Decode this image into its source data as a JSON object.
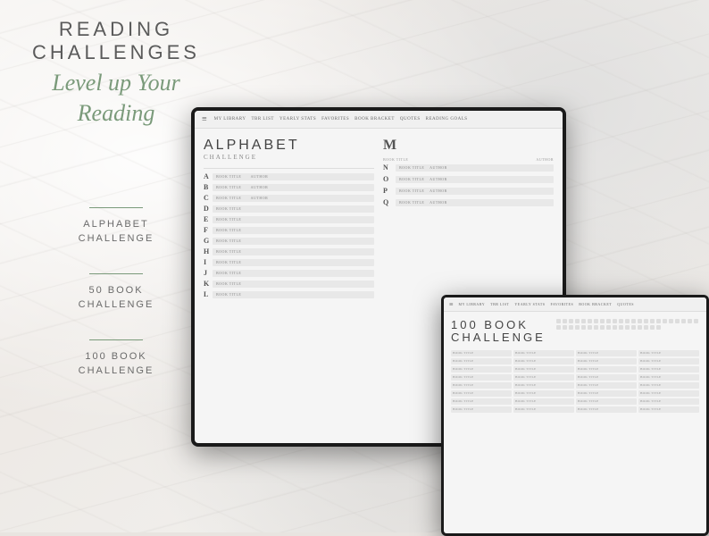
{
  "header": {
    "title_line1": "READING CHALLENGES",
    "title_line2": "Level up Your Reading"
  },
  "challenges": [
    {
      "label": "ALPHABET\nCHALLENGE"
    },
    {
      "label": "50 BOOK\nCHALLENGE"
    },
    {
      "label": "100 BOOK\nCHALLENGE"
    }
  ],
  "nav_items": [
    "MY LIBRARY",
    "TBR LIST",
    "YEARLY STATS",
    "FAVORITES",
    "BOOK BRACKET",
    "QUOTES",
    "READING GOALS"
  ],
  "alphabet_title": "ALPHABET",
  "alphabet_subtitle": "CHALLENGE",
  "letters_left": [
    "A",
    "B",
    "C",
    "D",
    "E",
    "F",
    "G",
    "H",
    "I",
    "J",
    "K",
    "L"
  ],
  "letters_right": [
    "M",
    "N",
    "O",
    "P",
    "Q"
  ],
  "book100_title_line1": "100 BOOK",
  "book100_title_line2": "CHALLENGE",
  "field_labels": [
    "BOOK TITLE",
    "AUTHOR"
  ],
  "book_title_placeholder": "BOOK TITLE",
  "author_placeholder": "AUTHOR"
}
